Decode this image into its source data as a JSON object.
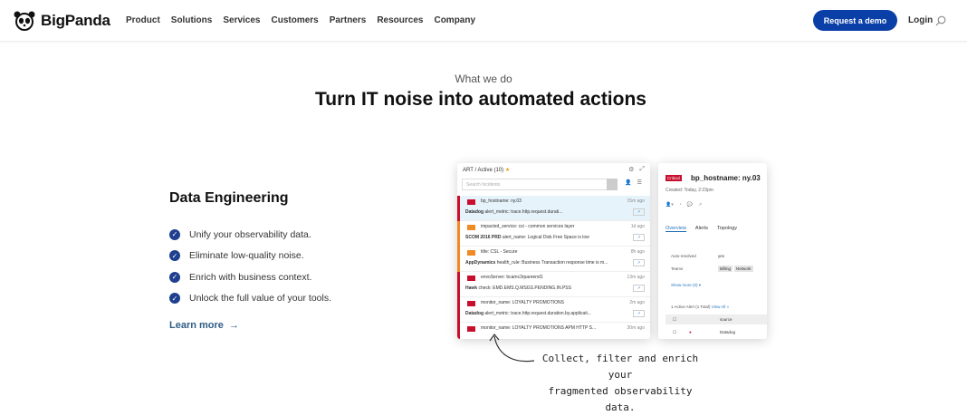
{
  "nav": {
    "logo": "BigPanda",
    "items": [
      "Product",
      "Solutions",
      "Services",
      "Customers",
      "Partners",
      "Resources",
      "Company"
    ],
    "cta": "Request a demo",
    "login": "Login"
  },
  "hero": {
    "eyebrow": "What we do",
    "title": "Turn IT noise into automated actions"
  },
  "feature": {
    "title": "Data Engineering",
    "bullets": [
      "Unify your observability data.",
      "Eliminate low-quality noise.",
      "Enrich with business context.",
      "Unlock the full value of your tools."
    ],
    "link": "Learn more"
  },
  "left_panel": {
    "header": "ART / Active (10)",
    "search_placeholder": "Search Incidents",
    "incidents": [
      {
        "title": "bp_hostname: ny.03",
        "source": "Datadog",
        "detail": "alert_metric: trace.http.request.durati...",
        "time": "15m ago",
        "color": "#c8102e"
      },
      {
        "title": "impacted_service: csi - common services layer",
        "source": "SCOM 2016 PRD",
        "detail": "alert_name: Logical Disk Free Space is low",
        "time": "1d ago",
        "color": "#f08a24"
      },
      {
        "title": "title: CSL - Secure",
        "source": "AppDynamics",
        "detail": "health_rule: Business Transaction response time is m...",
        "time": "8h ago",
        "color": "#f08a24"
      },
      {
        "title": "envoServer: bcamc3rpareend1",
        "source": "Hawk",
        "detail": "check: EMD.EMS.Q.MSGS.PENDING.IN.PSS",
        "time": "13m ago",
        "color": "#c8102e"
      },
      {
        "title": "monitor_name: LOYALTY PROMOTIONS",
        "source": "Datadog",
        "detail": "alert_metric: trace.http.request.duration.by.applicati...",
        "time": "2m ago",
        "color": "#c8102e"
      },
      {
        "title": "monitor_name: LOYALTY PROMOTIONS  APM HTTP S...",
        "source": "",
        "detail": "",
        "time": "30m ago",
        "color": "#c8102e"
      }
    ]
  },
  "right_panel": {
    "badge": "Critical",
    "title": "bp_hostname: ny.03",
    "created": "Created: Today, 2:23pm",
    "tabs": [
      "Overview",
      "Alerts",
      "Topology"
    ],
    "rows": [
      {
        "label": "Auto-resolved",
        "value": "yes"
      },
      {
        "label": "Teams",
        "chips": [
          "Billing",
          "Network"
        ]
      }
    ],
    "show_more": "Show more (0) ▾",
    "alerts_header": "1 Active Alert (1 Total)",
    "view_all": "View All »",
    "table_header": "source",
    "table_row": "Datadog"
  },
  "caption": [
    "Collect, filter and enrich your",
    "fragmented observability data."
  ]
}
